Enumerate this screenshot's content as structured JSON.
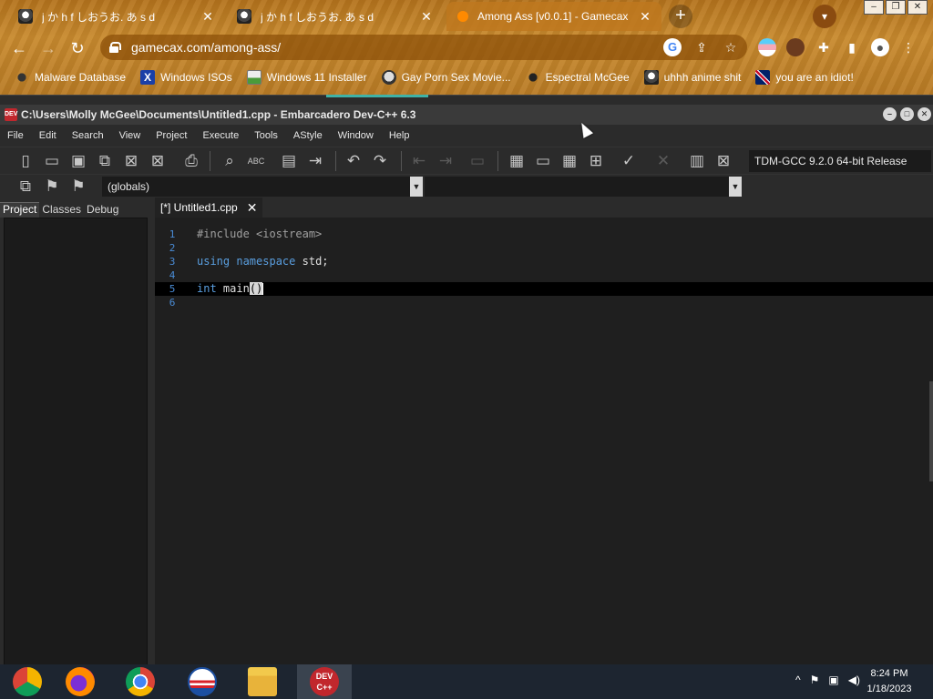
{
  "browser": {
    "tabs": [
      {
        "title": "j か h f しおうお. あ s d",
        "close": "✕",
        "favicon": "anime-face-icon",
        "active": false
      },
      {
        "title": "j か h f しおうお. あ s d",
        "close": "✕",
        "favicon": "anime-face-icon",
        "active": false
      },
      {
        "title": "Among Ass [v0.0.1] - Gamecax",
        "close": "✕",
        "favicon": "gamecax-icon",
        "active": true
      }
    ],
    "new_tab": "+",
    "url": "gamecax.com/among-ass/",
    "bookmarks": [
      {
        "label": "Malware Database",
        "icon": "malware-icon"
      },
      {
        "label": "Windows ISOs",
        "icon": "x-logo-icon"
      },
      {
        "label": "Windows 11 Installer",
        "icon": "image-icon"
      },
      {
        "label": "Gay Porn Sex Movie...",
        "icon": "skull-icon"
      },
      {
        "label": "Espectral McGee",
        "icon": "cat-icon"
      },
      {
        "label": "uhhh anime shit",
        "icon": "anime-face-icon"
      },
      {
        "label": "you are an idiot!",
        "icon": "uk-flag-icon"
      }
    ],
    "colors": {
      "chrome": "#b4731d",
      "omnibox": "#8c500a"
    }
  },
  "ide": {
    "title": "C:\\Users\\Molly McGee\\Documents\\Untitled1.cpp - Embarcadero Dev-C++ 6.3",
    "app_icon_text": "DEV",
    "menu": [
      "File",
      "Edit",
      "Search",
      "View",
      "Project",
      "Execute",
      "Tools",
      "AStyle",
      "Window",
      "Help"
    ],
    "compiler": "TDM-GCC 9.2.0 64-bit Release",
    "scope_combo": "(globals)",
    "panel_tabs": [
      "Project",
      "Classes",
      "Debug"
    ],
    "editor_tab": "[*] Untitled1.cpp",
    "editor_tab_close": "✕",
    "code_lines": [
      {
        "num": "1",
        "parts": [
          {
            "t": "#include <iostream>",
            "c": "pp"
          }
        ]
      },
      {
        "num": "2",
        "parts": []
      },
      {
        "num": "3",
        "parts": [
          {
            "t": "using",
            "c": "kw"
          },
          {
            "t": " ",
            "c": ""
          },
          {
            "t": "namespace",
            "c": "kw"
          },
          {
            "t": " std;",
            "c": ""
          }
        ]
      },
      {
        "num": "4",
        "parts": []
      },
      {
        "num": "5",
        "parts": [
          {
            "t": "int",
            "c": "kw"
          },
          {
            "t": " main",
            "c": ""
          },
          {
            "t": "()",
            "c": "paren"
          }
        ],
        "current": true
      },
      {
        "num": "6",
        "parts": []
      }
    ],
    "colors": {
      "background": "#1f1f1f",
      "keyword": "#5a9fe0",
      "line_number": "#4a8cd6"
    }
  },
  "taskbar": {
    "apps": [
      "chrome-canary-icon",
      "firefox-icon",
      "chrome-icon",
      "obama-logo-icon",
      "file-explorer-icon",
      "devcpp-icon"
    ],
    "devcpp_label": "DEV C++",
    "time": "8:24 PM",
    "date": "1/18/2023",
    "tray_icons": [
      "chevron-up-icon",
      "flag-icon",
      "network-icon",
      "volume-icon"
    ]
  }
}
